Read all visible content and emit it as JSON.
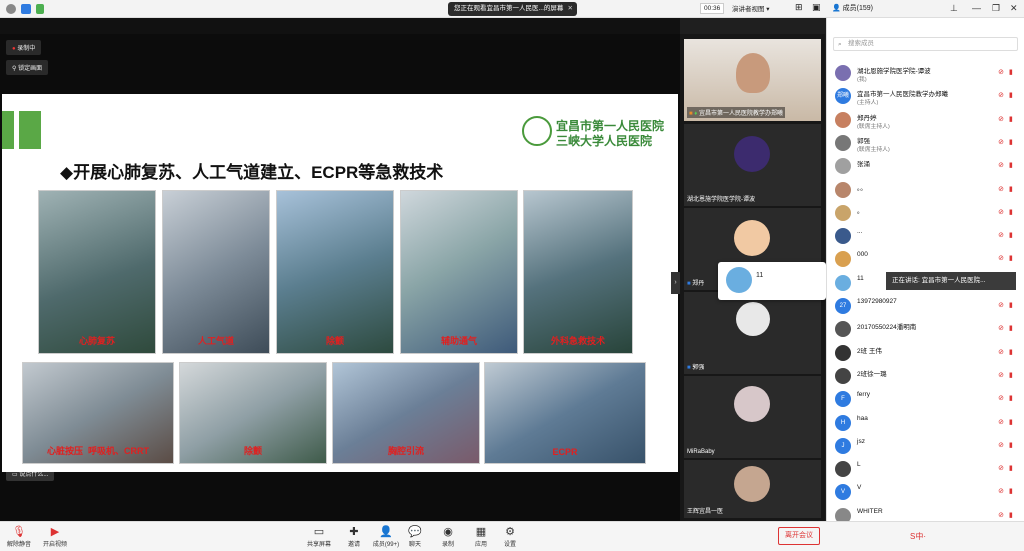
{
  "topbar": {
    "sharing_text": "您正在观看宜昌市第一人民医...的屏幕",
    "timer": "00:36",
    "view_mode": "演讲者视图",
    "members_title": "成员(159)"
  },
  "stage": {
    "recording": "录制中",
    "lock_screen": "锁定画面",
    "type_hint": "说点什么..."
  },
  "slide": {
    "title": "◆开展心肺复苏、人工气道建立、ECPR等急救技术",
    "hospital_line1": "宜昌市第一人民医院",
    "hospital_line2": "三峡大学人民医院",
    "captions": [
      "心肺复苏",
      "人工气道",
      "除颤",
      "辅助通气",
      "外科急救技术",
      "心脏按压",
      "呼吸机、CRRT",
      "除颤",
      "胸腔引流",
      "ECPR"
    ]
  },
  "videos": [
    {
      "name": "宜昌市第一人民医院教学办郑曦"
    },
    {
      "name": "湖北恩施学院医学院-谭波"
    },
    {
      "name": "郑丹"
    },
    {
      "name": "郭强"
    },
    {
      "name": "MiRaBaby"
    },
    {
      "name": "王辉宜昌一医"
    }
  ],
  "popup_name": "11",
  "speaking_tooltip": "正在讲话: 宜昌市第一人民医院...",
  "sidebar": {
    "search_placeholder": "搜索成员",
    "members": [
      {
        "name": "湖北恩施学院医学院-谭波",
        "role": "(我)",
        "color": "#7a6fb0"
      },
      {
        "name": "宜昌市第一人民医院教学办郑曦",
        "role": "(主持人)",
        "color": "#2f7be0",
        "avatar_text": "郑曦"
      },
      {
        "name": "郑丹婷",
        "role": "(联席主持人)",
        "color": "#c78060"
      },
      {
        "name": "郭强",
        "role": "(联席主持人)",
        "color": "#777"
      },
      {
        "name": "张涌",
        "role": "",
        "color": "#a0a0a0"
      },
      {
        "name": "。。",
        "role": "",
        "color": "#b8866b"
      },
      {
        "name": "。",
        "role": "",
        "color": "#c9a46a"
      },
      {
        "name": "...",
        "role": "",
        "color": "#3a5a8c"
      },
      {
        "name": "000",
        "role": "",
        "color": "#d9a050"
      },
      {
        "name": "11",
        "role": "",
        "color": "#6aaee0"
      },
      {
        "name": "13972980927",
        "role": "",
        "color": "#2f7be0",
        "avatar_text": "27"
      },
      {
        "name": "20170550224潘明南",
        "role": "",
        "color": "#555"
      },
      {
        "name": "2班 王伟",
        "role": "",
        "color": "#333"
      },
      {
        "name": "2班徐一璐",
        "role": "",
        "color": "#444"
      },
      {
        "name": "ferry",
        "role": "",
        "color": "#2f7be0",
        "avatar_text": "F"
      },
      {
        "name": "haa",
        "role": "",
        "color": "#2f7be0",
        "avatar_text": "H"
      },
      {
        "name": "jsz",
        "role": "",
        "color": "#2f7be0",
        "avatar_text": "J"
      },
      {
        "name": "L",
        "role": "",
        "color": "#444"
      },
      {
        "name": "V",
        "role": "",
        "color": "#2f7be0",
        "avatar_text": "V"
      },
      {
        "name": "WHITER",
        "role": "",
        "color": "#888"
      }
    ]
  },
  "bottom": {
    "unmute": "解除静音",
    "start_video": "开启视频",
    "share": "共享屏幕",
    "invite": "邀请",
    "members": "成员(99+)",
    "chat": "聊天",
    "record": "录制",
    "apps": "应用",
    "settings": "设置",
    "leave": "离开会议"
  }
}
